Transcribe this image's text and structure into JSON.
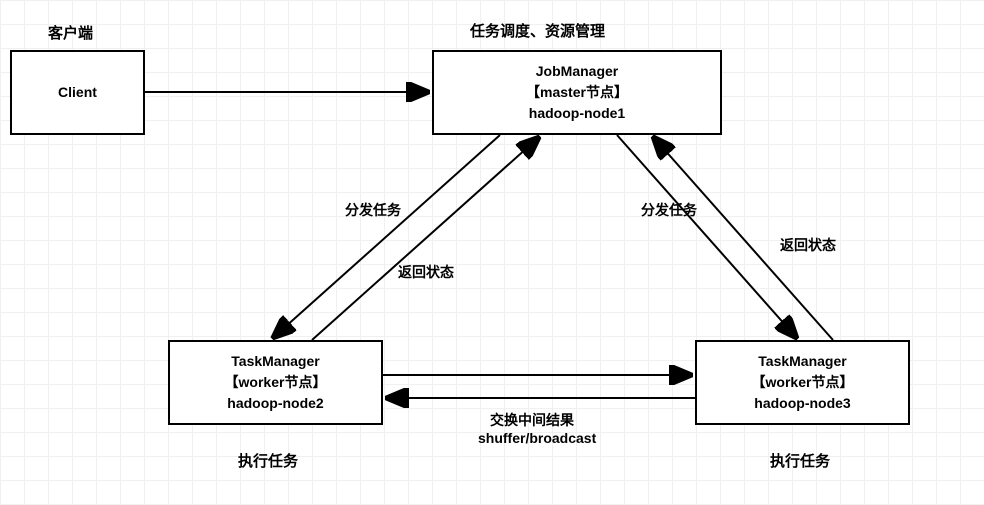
{
  "labels": {
    "client_caption": "客户端",
    "master_caption": "任务调度、资源管理",
    "exec_caption_left": "执行任务",
    "exec_caption_right": "执行任务"
  },
  "nodes": {
    "client": {
      "line1": "Client"
    },
    "jobmanager": {
      "line1": "JobManager",
      "line2": "【master节点】",
      "line3": "hadoop-node1"
    },
    "task2": {
      "line1": "TaskManager",
      "line2": "【worker节点】",
      "line3": "hadoop-node2"
    },
    "task3": {
      "line1": "TaskManager",
      "line2": "【worker节点】",
      "line3": "hadoop-node3"
    }
  },
  "edges": {
    "dispatch_left": "分发任务",
    "dispatch_right": "分发任务",
    "return_left": "返回状态",
    "return_right": "返回状态",
    "exchange_l1": "交换中间结果",
    "exchange_l2": "shuffer/broadcast"
  }
}
